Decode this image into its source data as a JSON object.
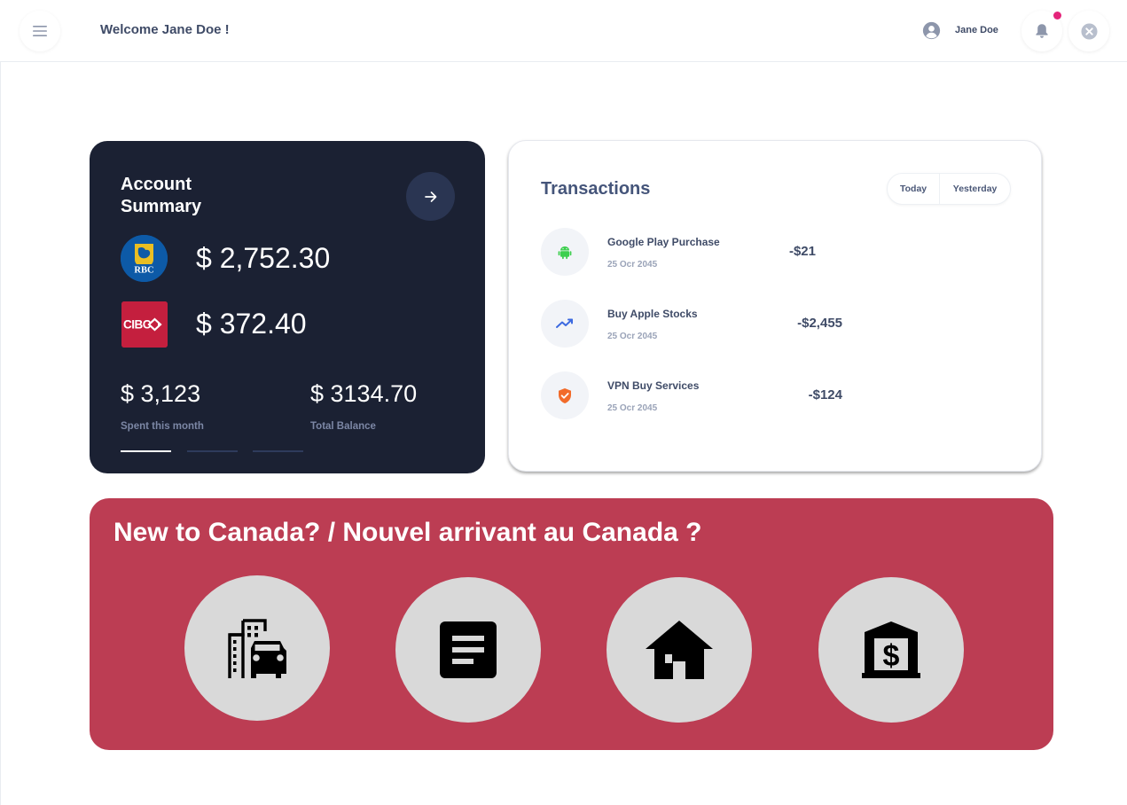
{
  "header": {
    "welcome": "Welcome Jane Doe !",
    "user_name": "Jane Doe",
    "notification_dot_color": "#e4247a",
    "icons": [
      "menu-icon",
      "user-circle-icon",
      "bell-icon",
      "close-circle-icon"
    ]
  },
  "summary": {
    "title": "Account Summary",
    "accounts": [
      {
        "bank": "RBC",
        "logo_text": "RBC",
        "amount": "$ 2,752.30"
      },
      {
        "bank": "CIBC",
        "logo_text": "CIBC",
        "amount": "$ 372.40"
      }
    ],
    "spent_value": "$ 3,123",
    "spent_label": "Spent this month",
    "total_value": "$ 3134.70",
    "total_label": "Total Balance",
    "pager": {
      "pages": 3,
      "active": 1
    },
    "colors": {
      "background": "#1b2133",
      "button": "#2a3552"
    }
  },
  "transactions": {
    "title": "Transactions",
    "tabs": [
      "Today",
      "Yesterday"
    ],
    "items": [
      {
        "name": "Google Play Purchase",
        "date": "25 Ocr 2045",
        "amount": "-$21",
        "icon": "android-icon",
        "icon_color": "#3ccf4e"
      },
      {
        "name": "Buy Apple Stocks",
        "date": "25 Ocr 2045",
        "amount": "-$2,455",
        "icon": "trending-up-icon",
        "icon_color": "#3d6ae0"
      },
      {
        "name": "VPN Buy Services",
        "date": "25 Ocr 2045",
        "amount": "-$124",
        "icon": "shield-check-icon",
        "icon_color": "#f26b2a"
      }
    ]
  },
  "banner": {
    "title": "New to Canada? / Nouvel arrivant au Canada ?",
    "background": "#bc3d53",
    "services": [
      "city-transport-icon",
      "document-icon",
      "home-icon",
      "bank-dollar-icon"
    ]
  }
}
